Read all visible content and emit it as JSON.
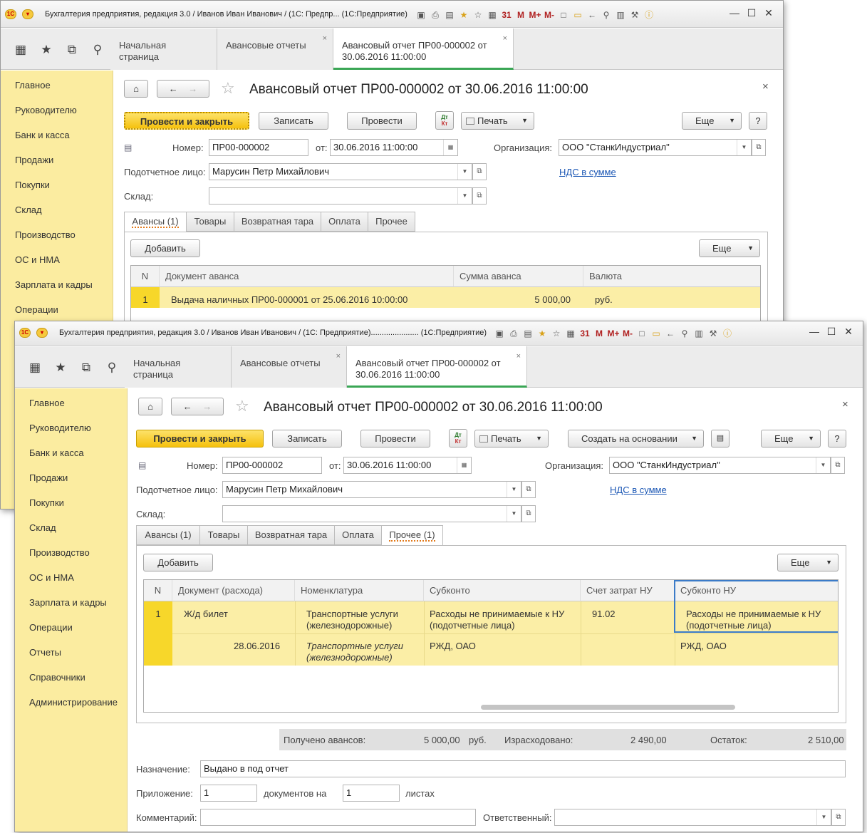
{
  "app_title_1": "Бухгалтерия предприятия, редакция 3.0 / Иванов Иван Иванович / (1С: Предпр...   (1С:Предприятие)",
  "app_title_2": "Бухгалтерия предприятия, редакция 3.0 / Иванов Иван Иванович / (1С: Предприятие)......................  (1С:Предприятие)",
  "tabs": {
    "home": "Начальная страница",
    "reports": "Авансовые отчеты",
    "doc": "Авансовый отчет ПР00-000002 от 30.06.2016 11:00:00"
  },
  "sidebar": [
    "Главное",
    "Руководителю",
    "Банк и касса",
    "Продажи",
    "Покупки",
    "Склад",
    "Производство",
    "ОС и НМА",
    "Зарплата и кадры",
    "Операции",
    "Отчеты",
    "Справочники",
    "Администрирование"
  ],
  "doc_title": "Авансовый отчет ПР00-000002 от 30.06.2016 11:00:00",
  "toolbar": {
    "post_close": "Провести и закрыть",
    "save": "Записать",
    "post": "Провести",
    "dt": "Дт",
    "kt": "Кт",
    "print": "Печать",
    "create_based": "Создать на основании",
    "more": "Еще",
    "help": "?"
  },
  "form": {
    "number_label": "Номер:",
    "number": "ПР00-000002",
    "date_label": "от:",
    "date": "30.06.2016 11:00:00",
    "org_label": "Организация:",
    "org": "ООО \"СтанкИндустриал\"",
    "person_label": "Подотчетное лицо:",
    "person": "Марусин Петр Михайлович",
    "vat_link": "НДС в сумме",
    "warehouse_label": "Склад:",
    "warehouse": ""
  },
  "form_tabs_1": [
    "Авансы (1)",
    "Товары",
    "Возвратная тара",
    "Оплата",
    "Прочее"
  ],
  "form_tabs_2": [
    "Авансы (1)",
    "Товары",
    "Возвратная тара",
    "Оплата",
    "Прочее (1)"
  ],
  "add_button": "Добавить",
  "grid1": {
    "headers": [
      "N",
      "Документ аванса",
      "Сумма аванса",
      "Валюта"
    ],
    "row": {
      "n": "1",
      "doc": "Выдача наличных ПР00-000001 от 25.06.2016 10:00:00",
      "sum": "5 000,00",
      "cur": "руб."
    }
  },
  "grid2": {
    "headers": [
      "N",
      "Документ (расхода)",
      "Номенклатура",
      "Субконто",
      "Счет затрат НУ",
      "Субконто НУ"
    ],
    "row": {
      "n": "1",
      "doc": "Ж/д билет",
      "doc_date": "28.06.2016",
      "nom": "Транспортные услуги (железнодорожные)",
      "nom2": "Транспортные услуги (железнодорожные)",
      "sub": "Расходы не принимаемые к НУ (подотчетные лица)",
      "sub2": "РЖД, ОАО",
      "acc": "91.02",
      "subnu": "Расходы не принимаемые к НУ (подотчетные лица)",
      "subnu2": "РЖД, ОАО"
    }
  },
  "totals": {
    "received_label": "Получено авансов:",
    "received": "5 000,00",
    "cur": "руб.",
    "spent_label": "Израсходовано:",
    "spent": "2 490,00",
    "rest_label": "Остаток:",
    "rest": "2 510,00"
  },
  "footer": {
    "purpose_label": "Назначение:",
    "purpose": "Выдано в под отчет",
    "attach_label": "Приложение:",
    "attach": "1",
    "docs_label": "документов на",
    "sheets": "1",
    "sheets_label": "листах",
    "comment_label": "Комментарий:",
    "comment": "",
    "resp_label": "Ответственный:",
    "resp": ""
  },
  "colors": {
    "accent": "#f5c10e",
    "sidebar": "#fbeca0",
    "row": "#fbeea6",
    "link": "#1a56b4",
    "active_tab": "#3aa655"
  }
}
